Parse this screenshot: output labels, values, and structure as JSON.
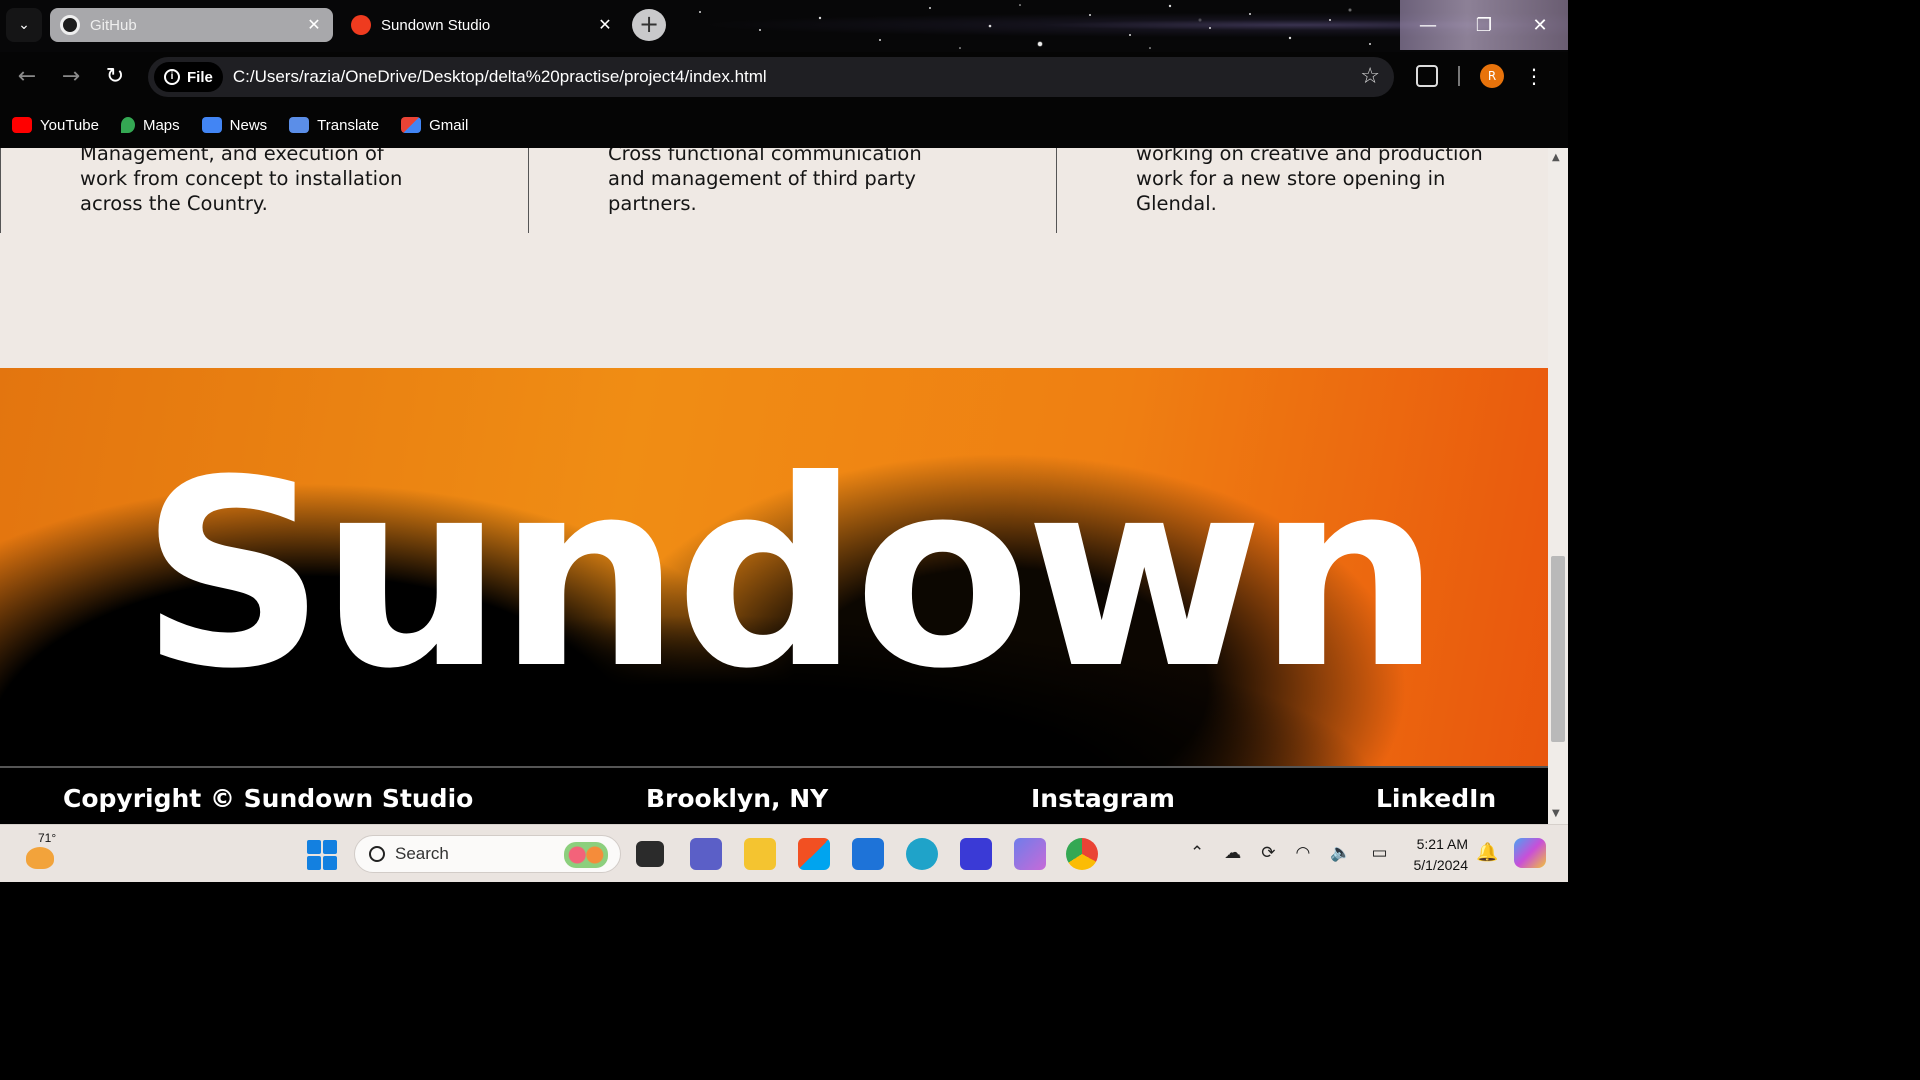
{
  "browser": {
    "tabs": [
      {
        "title": "GitHub",
        "active": false
      },
      {
        "title": "Sundown Studio",
        "active": true
      }
    ],
    "url_chip": "File",
    "url": "C:/Users/razia/OneDrive/Desktop/delta%20practise/project4/index.html",
    "profile_initial": "R",
    "bookmarks": [
      {
        "label": "YouTube",
        "icon": "youtube-icon",
        "color": "#ff0000"
      },
      {
        "label": "Maps",
        "icon": "maps-icon",
        "color": "#34a853"
      },
      {
        "label": "News",
        "icon": "news-icon",
        "color": "#4285f4"
      },
      {
        "label": "Translate",
        "icon": "translate-icon",
        "color": "#4285f4"
      },
      {
        "label": "Gmail",
        "icon": "gmail-icon",
        "color": "#ea4335"
      }
    ]
  },
  "page": {
    "cards": [
      {
        "text": "Management, and execution of work from concept to installation across the Country."
      },
      {
        "text": "Cross functional communication and management of third party partners."
      },
      {
        "text": "working on creative and production work for a new store opening in Glendal."
      }
    ],
    "hero_title": "Sundown",
    "footer": {
      "copyright": "Copyright © Sundown Studio",
      "location": "Brooklyn, NY",
      "instagram": "Instagram",
      "linkedin": "LinkedIn"
    },
    "colors": {
      "background": "#efe9e4",
      "accent": "#f08d14",
      "footer": "#000000"
    }
  },
  "taskbar": {
    "weather_temp": "71°",
    "search_placeholder": "Search",
    "time": "5:21 AM",
    "date": "5/1/2024"
  }
}
